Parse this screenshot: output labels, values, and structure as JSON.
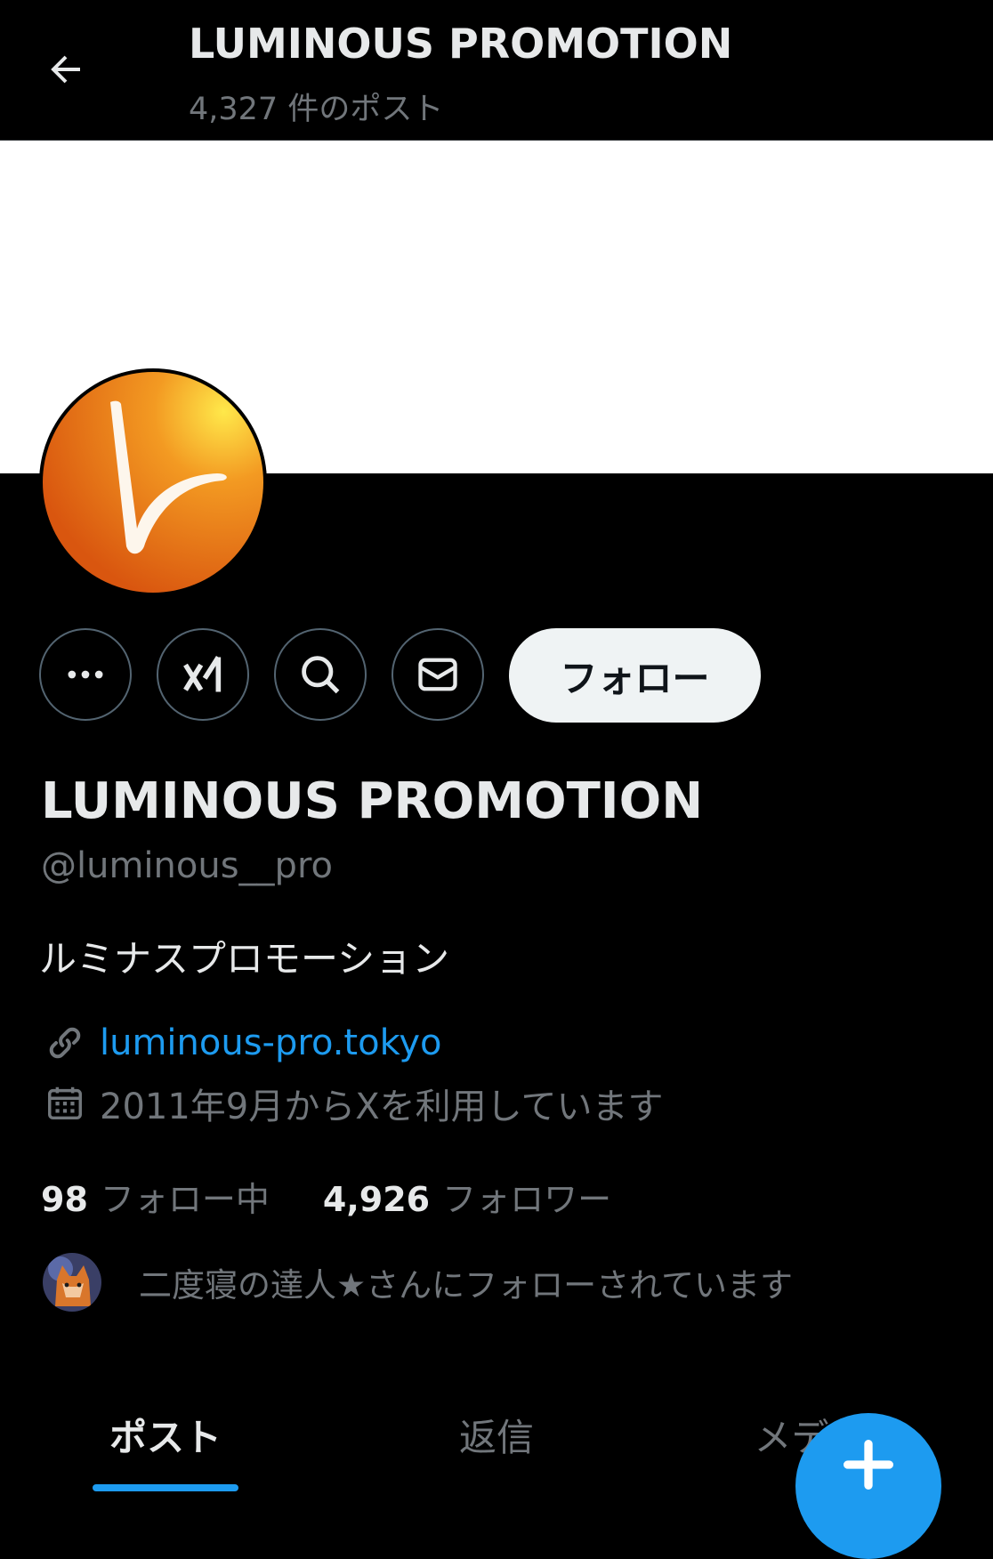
{
  "header": {
    "back_icon": "arrow-left-icon",
    "title": "LUMINOUS PROMOTION",
    "post_count": "4,327 件のポスト"
  },
  "colors": {
    "background": "#000000",
    "banner": "#ffffff",
    "accent": "#1d9bf0",
    "muted_text": "#71767b",
    "follow_button_bg": "#eff3f4",
    "avatar_orange": "#e8701a"
  },
  "actions": {
    "more_icon": "more-icon",
    "grok_icon": "grok-icon",
    "search_icon": "search-icon",
    "message_icon": "message-icon",
    "follow_label": "フォロー"
  },
  "profile": {
    "name": "LUMINOUS PROMOTION",
    "handle": "@luminous__pro",
    "bio": "ルミナスプロモーション",
    "link_icon": "link-icon",
    "link": "luminous-pro.tokyo",
    "calendar_icon": "calendar-icon",
    "joined": "2011年9月からXを利用しています"
  },
  "stats": {
    "following_count": "98",
    "following_label": "フォロー中",
    "followers_count": "4,926",
    "followers_label": "フォロワー"
  },
  "followed_by": {
    "text": "二度寝の達人★さんにフォローされています"
  },
  "tabs": [
    {
      "label": "ポスト",
      "active": true
    },
    {
      "label": "返信",
      "active": false
    },
    {
      "label": "メディア",
      "active": false
    }
  ],
  "fab_icon": "compose-icon"
}
